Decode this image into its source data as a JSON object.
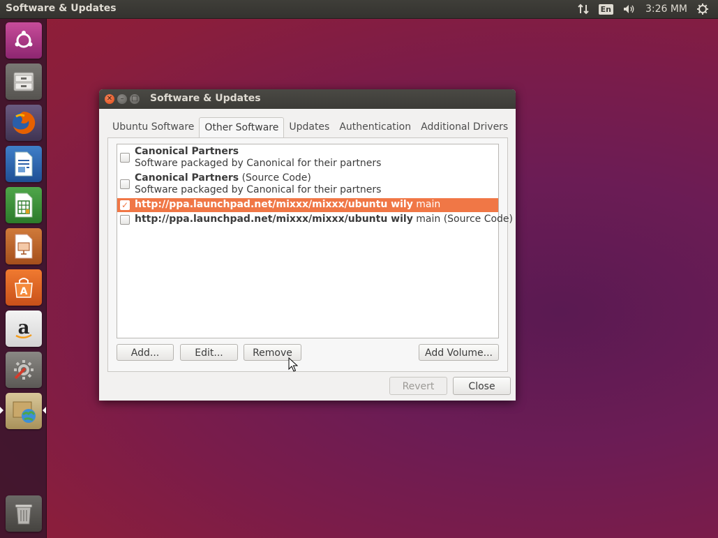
{
  "top_panel": {
    "title": "Software & Updates",
    "keyboard": "En",
    "clock": "3:26 MM",
    "icons": [
      "network-arrows-icon",
      "volume-icon",
      "power-gear-icon"
    ]
  },
  "launcher": {
    "items": [
      "ubuntu-logo-icon",
      "files-icon",
      "firefox-icon",
      "writer-icon",
      "calc-icon",
      "impress-icon",
      "software-center-icon",
      "amazon-icon",
      "system-settings-icon",
      "software-updates-icon",
      "trash-icon"
    ]
  },
  "window": {
    "title": "Software & Updates",
    "tabs": [
      {
        "label": "Ubuntu Software"
      },
      {
        "label": "Other Software"
      },
      {
        "label": "Updates"
      },
      {
        "label": "Authentication"
      },
      {
        "label": "Additional Drivers"
      }
    ],
    "active_tab": "Other Software",
    "sources": [
      {
        "bold": "Canonical Partners",
        "suffix": "",
        "desc": "Software packaged by Canonical for their partners",
        "checked": false,
        "selected": false
      },
      {
        "bold": "Canonical Partners",
        "suffix": " (Source Code)",
        "desc": "Software packaged by Canonical for their partners",
        "checked": false,
        "selected": false
      },
      {
        "bold": "http://ppa.launchpad.net/mixxx/mixxx/ubuntu wily",
        "suffix": " main",
        "desc": "",
        "checked": true,
        "selected": true
      },
      {
        "bold": "http://ppa.launchpad.net/mixxx/mixxx/ubuntu wily",
        "suffix": " main (Source Code)",
        "desc": "",
        "checked": false,
        "selected": false
      }
    ],
    "buttons": {
      "add": "Add...",
      "edit": "Edit...",
      "remove": "Remove",
      "add_volume": "Add Volume...",
      "revert": "Revert",
      "close": "Close"
    }
  },
  "colors": {
    "selection": "#f07746",
    "close_button": "#df4a16",
    "panel": "#3c3b37"
  }
}
